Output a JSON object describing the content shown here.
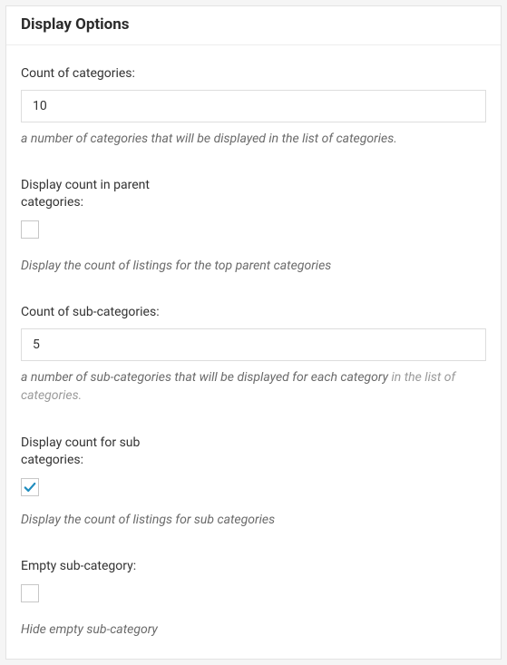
{
  "panel": {
    "title": "Display Options"
  },
  "fields": {
    "count_categories": {
      "label": "Count of categories:",
      "value": "10",
      "help": "a number of categories that will be displayed in the list of categories."
    },
    "display_count_parent": {
      "label": "Display count in parent categories:",
      "checked": false,
      "help": "Display the count of listings for the top parent categories"
    },
    "count_subcategories": {
      "label": "Count of sub-categories:",
      "value": "5",
      "help_a": "a number of sub-categories that will be displayed for each category",
      "help_b": " in the list of categories."
    },
    "display_count_sub": {
      "label": "Display count for sub categories:",
      "checked": true,
      "help": "Display the count of listings for sub categories"
    },
    "empty_subcategory": {
      "label": "Empty sub-category:",
      "checked": false,
      "help": "Hide empty sub-category"
    }
  }
}
